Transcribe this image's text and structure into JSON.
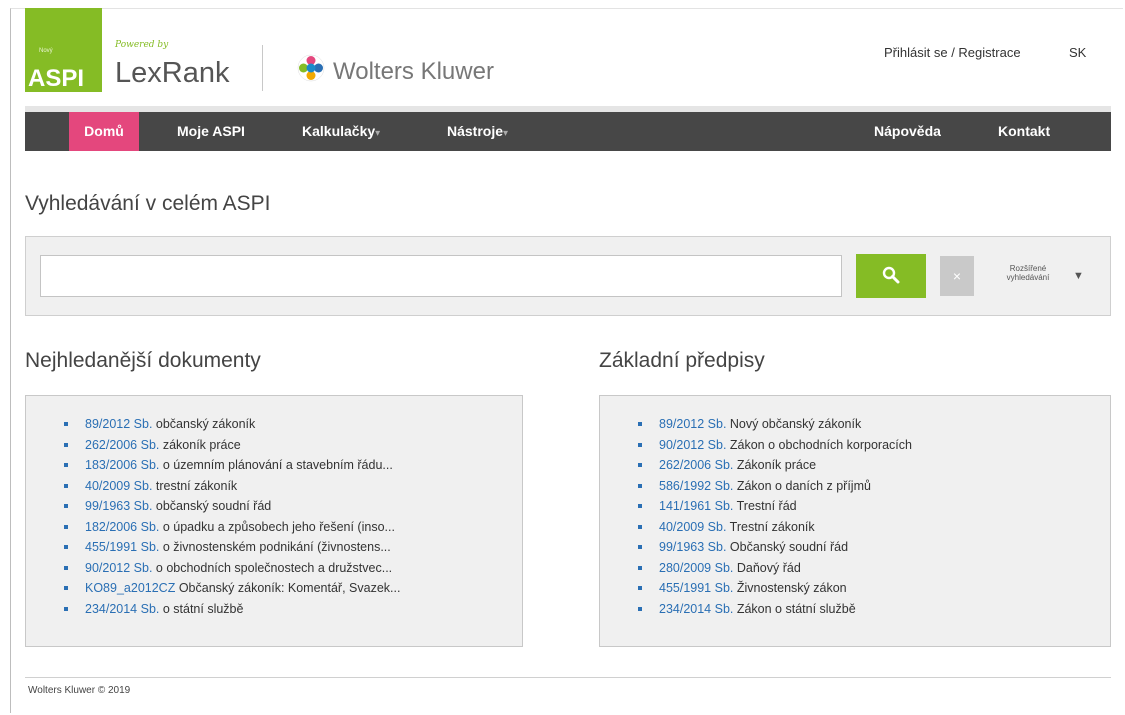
{
  "header": {
    "logo_small": "Nový",
    "logo_text": "ASPI",
    "powered_by": "Powered by",
    "lexrank": "LexRank",
    "partner": "Wolters Kluwer",
    "login": "Přihlásit se / Registrace",
    "language": "SK"
  },
  "nav": {
    "items": [
      {
        "label": "Domů",
        "active": true
      },
      {
        "label": "Moje ASPI"
      },
      {
        "label": "Kalkulačky"
      },
      {
        "label": "Nástroje"
      }
    ],
    "right_items": [
      {
        "label": "Nápověda"
      },
      {
        "label": "Kontakt"
      }
    ]
  },
  "search": {
    "title": "Vyhledávání v celém ASPI",
    "placeholder": "",
    "value": "",
    "clear_label": "×",
    "advanced_label_line1": "Rozšířené",
    "advanced_label_line2": "vyhledávání",
    "advanced_caret": "▼"
  },
  "popular": {
    "title": "Nejhledanější dokumenty",
    "items": [
      {
        "ref": "89/2012 Sb.",
        "text": " občanský zákoník"
      },
      {
        "ref": "262/2006 Sb.",
        "text": " zákoník práce"
      },
      {
        "ref": "183/2006 Sb.",
        "text": " o územním plánování a stavebním řádu..."
      },
      {
        "ref": "40/2009 Sb.",
        "text": " trestní zákoník"
      },
      {
        "ref": "99/1963 Sb.",
        "text": " občanský soudní řád"
      },
      {
        "ref": "182/2006 Sb.",
        "text": " o úpadku a způsobech jeho řešení (inso..."
      },
      {
        "ref": "455/1991 Sb.",
        "text": " o živnostenském podnikání (živnostens..."
      },
      {
        "ref": "90/2012 Sb.",
        "text": " o obchodních společnostech a družstvec..."
      },
      {
        "ref": "KO89_a2012CZ",
        "text": " Občanský zákoník: Komentář, Svazek..."
      },
      {
        "ref": "234/2014 Sb.",
        "text": " o státní službě"
      }
    ]
  },
  "basic": {
    "title": "Základní předpisy",
    "items": [
      {
        "ref": "89/2012 Sb.",
        "text": " Nový občanský zákoník"
      },
      {
        "ref": "90/2012 Sb.",
        "text": " Zákon o obchodních korporacích"
      },
      {
        "ref": "262/2006 Sb.",
        "text": " Zákoník práce"
      },
      {
        "ref": "586/1992 Sb.",
        "text": " Zákon o daních z příjmů"
      },
      {
        "ref": "141/1961 Sb.",
        "text": " Trestní řád"
      },
      {
        "ref": "40/2009 Sb.",
        "text": " Trestní zákoník"
      },
      {
        "ref": "99/1963 Sb.",
        "text": " Občanský soudní řád"
      },
      {
        "ref": "280/2009 Sb.",
        "text": " Daňový řád"
      },
      {
        "ref": "455/1991 Sb.",
        "text": " Živnostenský zákon"
      },
      {
        "ref": "234/2014 Sb.",
        "text": " Zákon o státní službě"
      }
    ]
  },
  "footer": {
    "text": "Wolters Kluwer © 2019"
  },
  "colors": {
    "brand_green": "#85bc25",
    "nav_bg": "#474747",
    "nav_active": "#e4477d",
    "link_blue": "#2a6fb4",
    "panel_bg": "#f0f0f0"
  },
  "icons": {
    "search_button": "search-icon",
    "partner_logo": "wolters-kluwer-logo-icon"
  }
}
